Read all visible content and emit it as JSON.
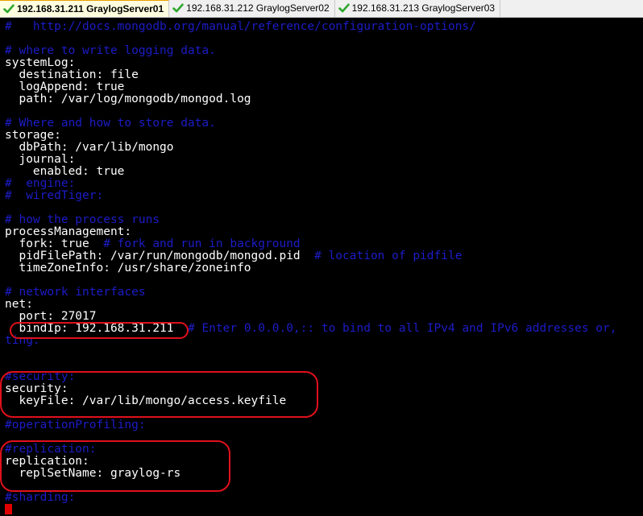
{
  "tabs": [
    {
      "label": "192.168.31.211 GraylogServer01",
      "active": true,
      "icon": "check-icon"
    },
    {
      "label": "192.168.31.212 GraylogServer02",
      "active": false,
      "icon": "check-icon"
    },
    {
      "label": "192.168.31.213 GraylogServer03",
      "active": false,
      "icon": "check-icon"
    }
  ],
  "colors": {
    "text": "#ffffff",
    "comment": "#1c1cc8",
    "background": "#000000",
    "highlight": "#e0101c",
    "check": "#2fa82f"
  },
  "terminal": {
    "lines": [
      {
        "parts": [
          {
            "text": "#   http://docs.mongodb.org/manual/reference/configuration-options/",
            "kind": "c"
          }
        ]
      },
      {
        "parts": [
          {
            "text": "",
            "kind": "t"
          }
        ]
      },
      {
        "parts": [
          {
            "text": "# where to write logging data.",
            "kind": "c"
          }
        ]
      },
      {
        "parts": [
          {
            "text": "systemLog:",
            "kind": "t"
          }
        ]
      },
      {
        "parts": [
          {
            "text": "  destination: file",
            "kind": "t"
          }
        ]
      },
      {
        "parts": [
          {
            "text": "  logAppend: true",
            "kind": "t"
          }
        ]
      },
      {
        "parts": [
          {
            "text": "  path: /var/log/mongodb/mongod.log",
            "kind": "t"
          }
        ]
      },
      {
        "parts": [
          {
            "text": "",
            "kind": "t"
          }
        ]
      },
      {
        "parts": [
          {
            "text": "# Where and how to store data.",
            "kind": "c"
          }
        ]
      },
      {
        "parts": [
          {
            "text": "storage:",
            "kind": "t"
          }
        ]
      },
      {
        "parts": [
          {
            "text": "  dbPath: /var/lib/mongo",
            "kind": "t"
          }
        ]
      },
      {
        "parts": [
          {
            "text": "  journal:",
            "kind": "t"
          }
        ]
      },
      {
        "parts": [
          {
            "text": "    enabled: true",
            "kind": "t"
          }
        ]
      },
      {
        "parts": [
          {
            "text": "#  engine:",
            "kind": "c"
          }
        ]
      },
      {
        "parts": [
          {
            "text": "#  wiredTiger:",
            "kind": "c"
          }
        ]
      },
      {
        "parts": [
          {
            "text": "",
            "kind": "t"
          }
        ]
      },
      {
        "parts": [
          {
            "text": "# how the process runs",
            "kind": "c"
          }
        ]
      },
      {
        "parts": [
          {
            "text": "processManagement:",
            "kind": "t"
          }
        ]
      },
      {
        "parts": [
          {
            "text": "  fork: true  ",
            "kind": "t"
          },
          {
            "text": "# fork and run in background",
            "kind": "c"
          }
        ]
      },
      {
        "parts": [
          {
            "text": "  pidFilePath: /var/run/mongodb/mongod.pid  ",
            "kind": "t"
          },
          {
            "text": "# location of pidfile",
            "kind": "c"
          }
        ]
      },
      {
        "parts": [
          {
            "text": "  timeZoneInfo: /usr/share/zoneinfo",
            "kind": "t"
          }
        ]
      },
      {
        "parts": [
          {
            "text": "",
            "kind": "t"
          }
        ]
      },
      {
        "parts": [
          {
            "text": "# network interfaces",
            "kind": "c"
          }
        ]
      },
      {
        "parts": [
          {
            "text": "net:",
            "kind": "t"
          }
        ]
      },
      {
        "parts": [
          {
            "text": "  port: 27017",
            "kind": "t"
          }
        ]
      },
      {
        "parts": [
          {
            "text": "  bindIp: 192.168.31.211  ",
            "kind": "t"
          },
          {
            "text": "# Enter 0.0.0.0,:: to bind to all IPv4 and IPv6 addresses or,",
            "kind": "c"
          }
        ]
      },
      {
        "parts": [
          {
            "text": "ting.",
            "kind": "c"
          }
        ]
      },
      {
        "parts": [
          {
            "text": "",
            "kind": "t"
          }
        ]
      },
      {
        "parts": [
          {
            "text": "",
            "kind": "t"
          }
        ]
      },
      {
        "parts": [
          {
            "text": "#security:",
            "kind": "c"
          }
        ]
      },
      {
        "parts": [
          {
            "text": "security:",
            "kind": "t"
          }
        ]
      },
      {
        "parts": [
          {
            "text": "  keyFile: /var/lib/mongo/access.keyfile",
            "kind": "t"
          }
        ]
      },
      {
        "parts": [
          {
            "text": "",
            "kind": "t"
          }
        ]
      },
      {
        "parts": [
          {
            "text": "#operationProfiling:",
            "kind": "c"
          }
        ]
      },
      {
        "parts": [
          {
            "text": "",
            "kind": "t"
          }
        ]
      },
      {
        "parts": [
          {
            "text": "#replication:",
            "kind": "c"
          }
        ]
      },
      {
        "parts": [
          {
            "text": "replication:",
            "kind": "t"
          }
        ]
      },
      {
        "parts": [
          {
            "text": "  replSetName: graylog-rs",
            "kind": "t"
          }
        ]
      },
      {
        "parts": [
          {
            "text": "",
            "kind": "t"
          }
        ]
      },
      {
        "parts": [
          {
            "text": "#sharding:",
            "kind": "c"
          }
        ]
      }
    ]
  }
}
